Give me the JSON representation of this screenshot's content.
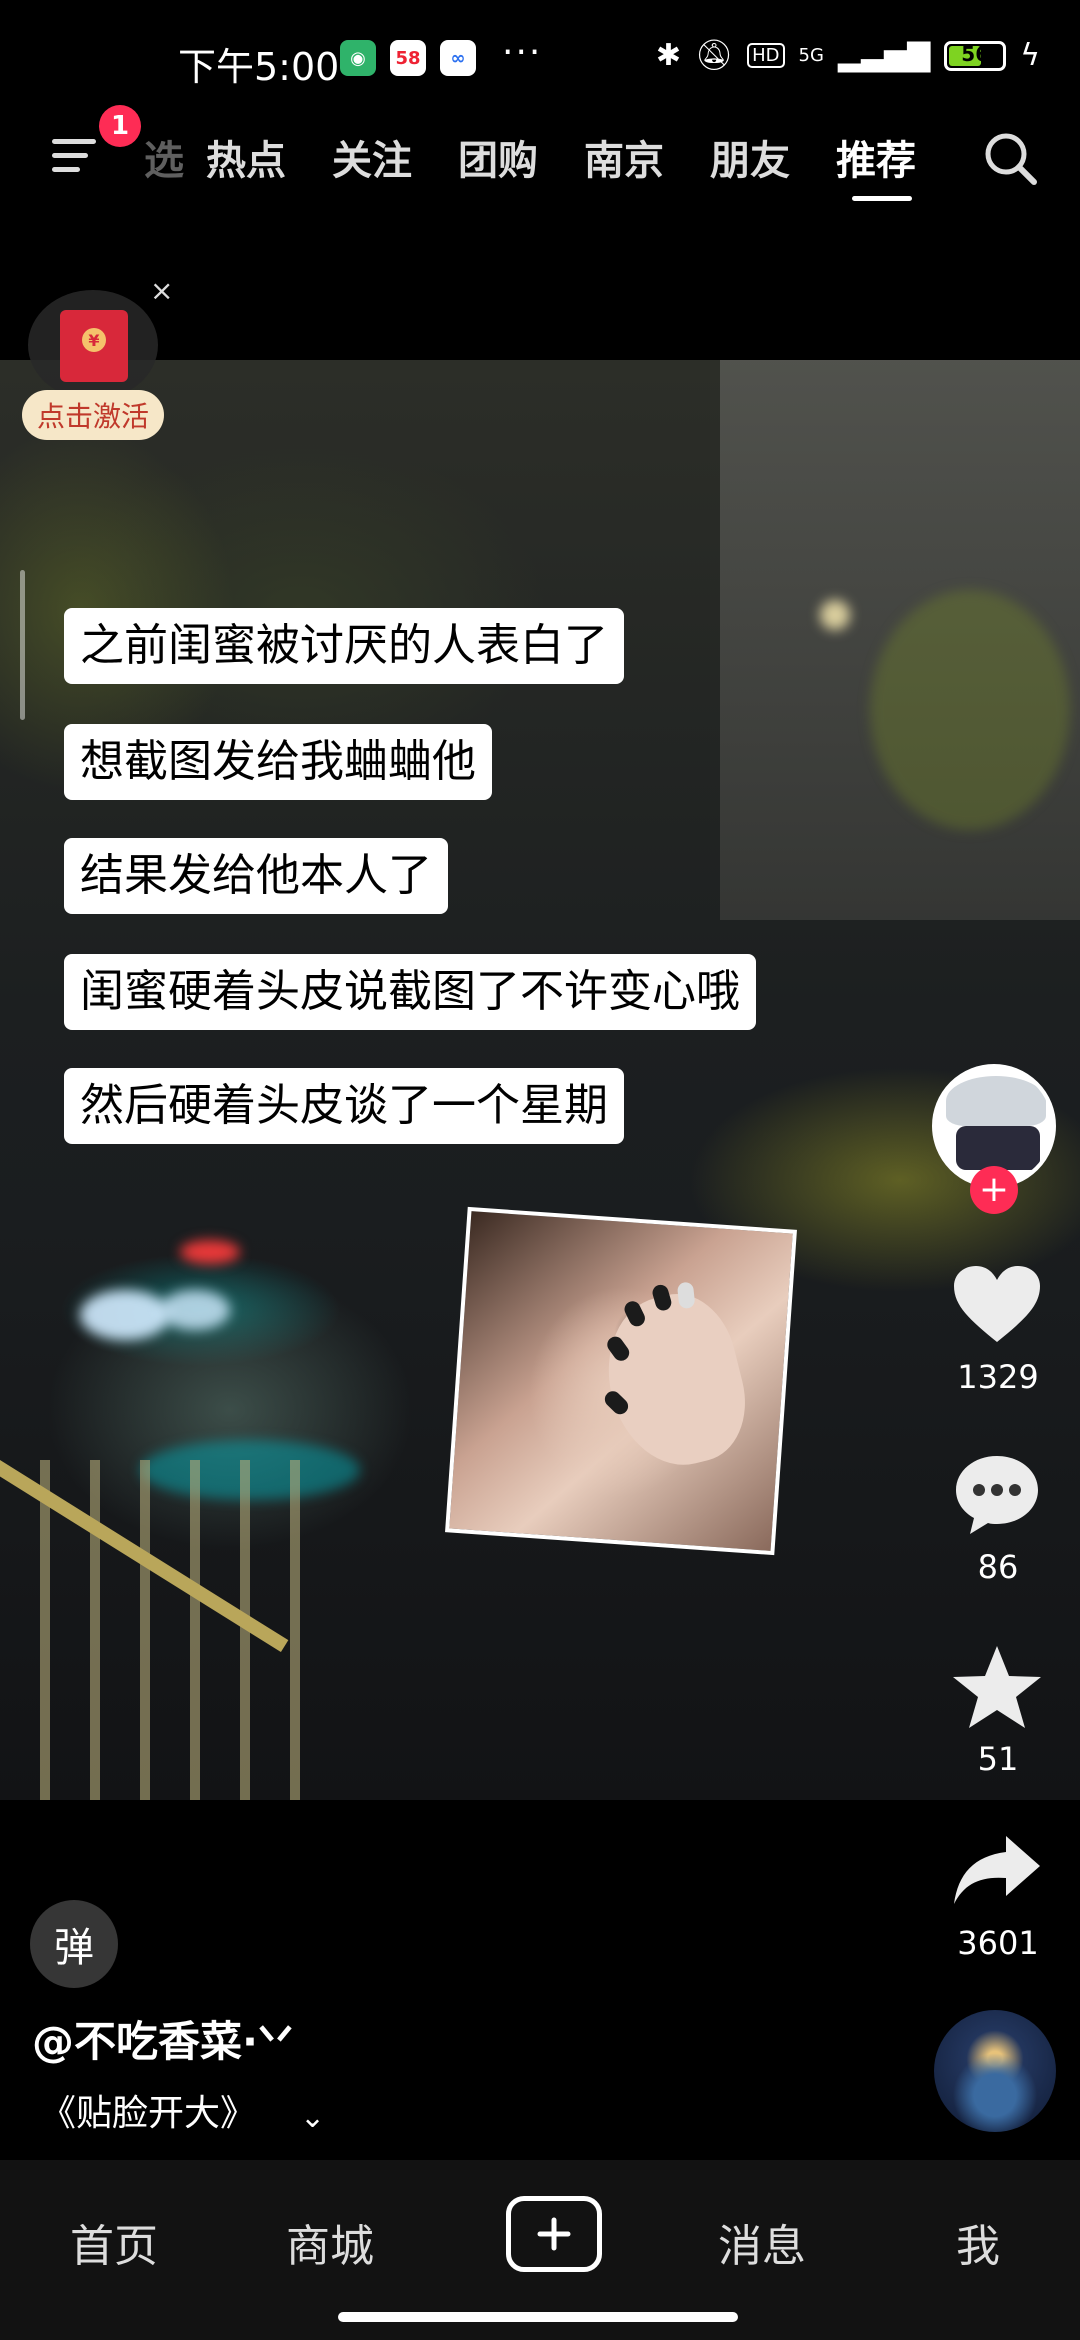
{
  "status_bar": {
    "time": "下午5:00",
    "app_badge_58": "58",
    "more": "···",
    "network": "5G",
    "hd": "HD",
    "battery": "56",
    "battery_level": 0.56
  },
  "top_nav": {
    "notification_count": "1",
    "partial_tab": "选",
    "tabs": [
      "热点",
      "关注",
      "团购",
      "南京",
      "朋友",
      "推荐"
    ],
    "active_tab": "推荐"
  },
  "redpack": {
    "label": "点击激活",
    "close": "×",
    "seal": "¥"
  },
  "captions": [
    "之前闺蜜被讨厌的人表白了",
    "想截图发给我蛐蛐他",
    "结果发给他本人了",
    "闺蜜硬着头皮说截图了不许变心哦",
    "然后硬着头皮谈了一个星期"
  ],
  "actions": {
    "follow": "+",
    "likes": "1329",
    "comments": "86",
    "favorites": "51",
    "shares": "3601"
  },
  "video_info": {
    "danmaku": "弹",
    "author": "@不吃香菜·ᐠᐟ",
    "music": "《贴脸开大》",
    "music_chevron": "⌄"
  },
  "bottom_nav": {
    "items": [
      "首页",
      "商城",
      "消息",
      "我"
    ]
  },
  "colors": {
    "accent": "#fe2c55",
    "caption_bg": "#ffffff",
    "redpack": "#d8283a"
  }
}
